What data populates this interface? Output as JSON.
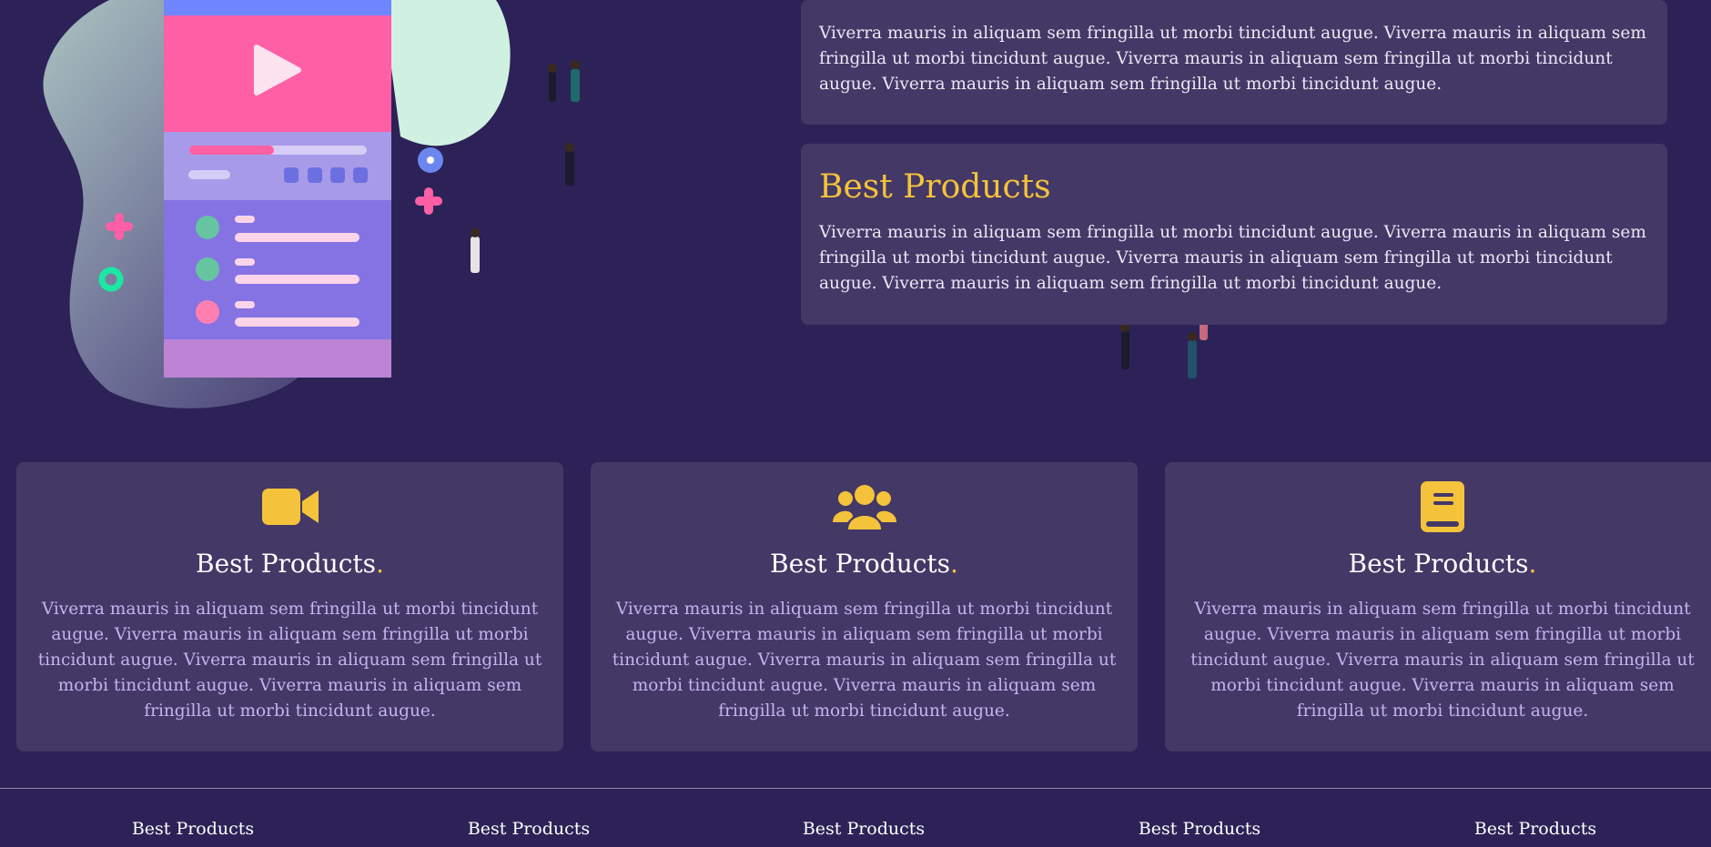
{
  "top_card": {
    "text": "Viverra mauris in aliquam sem fringilla ut morbi tincidunt augue. Viverra mauris in aliquam sem fringilla ut morbi tincidunt augue. Viverra mauris in aliquam sem fringilla ut morbi tincidunt augue. Viverra mauris in aliquam sem fringilla ut morbi tincidunt augue."
  },
  "mid_card": {
    "title": "Best Products",
    "text": "Viverra mauris in aliquam sem fringilla ut morbi tincidunt augue. Viverra mauris in aliquam sem fringilla ut morbi tincidunt augue. Viverra mauris in aliquam sem fringilla ut morbi tincidunt augue. Viverra mauris in aliquam sem fringilla ut morbi tincidunt augue."
  },
  "features": [
    {
      "icon": "video-camera-icon",
      "title": "Best Products",
      "dot": ".",
      "text": "Viverra mauris in aliquam sem fringilla ut morbi tincidunt augue. Viverra mauris in aliquam sem fringilla ut morbi tincidunt augue. Viverra mauris in aliquam sem fringilla ut morbi tincidunt augue. Viverra mauris in aliquam sem fringilla ut morbi tincidunt augue."
    },
    {
      "icon": "users-group-icon",
      "title": "Best Products",
      "dot": ".",
      "text": "Viverra mauris in aliquam sem fringilla ut morbi tincidunt augue. Viverra mauris in aliquam sem fringilla ut morbi tincidunt augue. Viverra mauris in aliquam sem fringilla ut morbi tincidunt augue. Viverra mauris in aliquam sem fringilla ut morbi tincidunt augue."
    },
    {
      "icon": "book-icon",
      "title": "Best Products",
      "dot": ".",
      "text": "Viverra mauris in aliquam sem fringilla ut morbi tincidunt augue. Viverra mauris in aliquam sem fringilla ut morbi tincidunt augue. Viverra mauris in aliquam sem fringilla ut morbi tincidunt augue. Viverra mauris in aliquam sem fringilla ut morbi tincidunt augue."
    }
  ],
  "footer": {
    "links": [
      "Best Products",
      "Best Products",
      "Best Products",
      "Best Products",
      "Best Products"
    ]
  },
  "colors": {
    "background": "#2c2257",
    "card": "#433866",
    "accent": "#f5c33b",
    "body_text": "#c5b3ef"
  }
}
